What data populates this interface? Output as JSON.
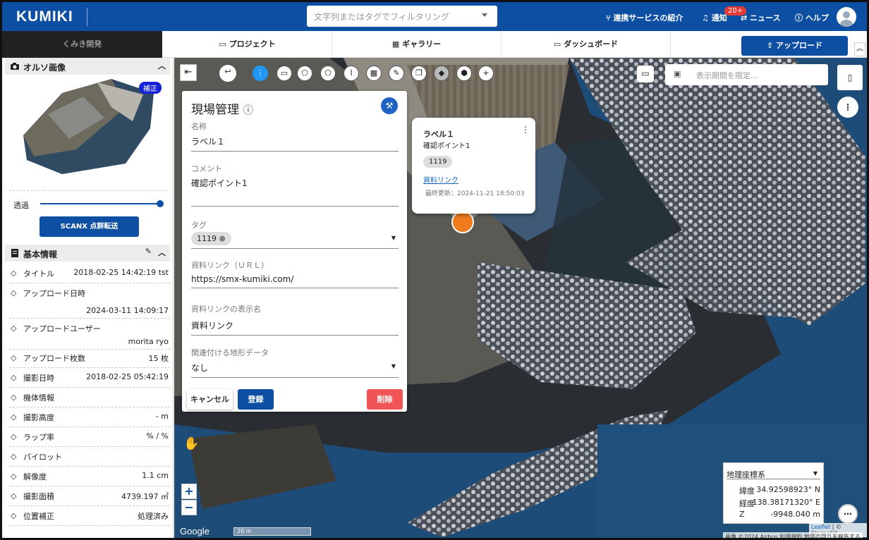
{
  "header": {
    "logo": "KUMIKI",
    "search_placeholder": "文字列またはタグでフィルタリング",
    "links": {
      "integration": "連携サービスの紹介",
      "notify": "通知",
      "notify_badge": "20+",
      "news": "ニュース",
      "help": "ヘルプ"
    }
  },
  "nav": {
    "org": "くみき開発",
    "tabs": [
      "プロジェクト",
      "ギャラリー",
      "ダッシュボード"
    ],
    "upload": "アップロード"
  },
  "sidebar": {
    "ortho_title": "オルソ画像",
    "ortho_badge": "補正",
    "opacity_label": "透過",
    "opacity_value": 1.0,
    "scanx_button": "SCANX 点群転送",
    "basic_title": "基本情報",
    "rows": [
      {
        "label": "タイトル",
        "value": "2018-02-25 14:42:19 tst"
      },
      {
        "label": "アップロード日時",
        "value": "2024-03-11 14:09:17"
      },
      {
        "label": "アップロードユーザー",
        "value": "morita ryo"
      },
      {
        "label": "アップロード枚数",
        "value": "15 枚"
      },
      {
        "label": "撮影日時",
        "value": "2018-02-25 05:42:19"
      },
      {
        "label": "機体情報",
        "value": ""
      },
      {
        "label": "撮影高度",
        "value": "- m"
      },
      {
        "label": "ラップ率",
        "value": "% / %"
      },
      {
        "label": "パイロット",
        "value": ""
      },
      {
        "label": "解像度",
        "value": "1.1 cm"
      },
      {
        "label": "撮影面積",
        "value": "4739.197 ㎡"
      },
      {
        "label": "位置補正",
        "value": "処理済み"
      }
    ]
  },
  "panel": {
    "title": "現場管理",
    "name_label": "名称",
    "name_value": "ラベル１",
    "comment_label": "コメント",
    "comment_value": "確認ポイント1",
    "tag_label": "タグ",
    "tag_chip": "1119",
    "link_label": "資料リンク（ＵＲＬ）",
    "link_value": "https://smx-kumiki.com/",
    "link_name_label": "資料リンクの表示名",
    "link_name_value": "資料リンク",
    "terrain_label": "関連付ける地形データ",
    "terrain_value": "なし",
    "cancel": "キャンセル",
    "save": "登録",
    "delete": "削除"
  },
  "popup": {
    "title": "ラベル１",
    "comment": "確認ポイント1",
    "chip": "1119",
    "link": "資料リンク",
    "updated": "最終更新：2024-11-21 18:50:03"
  },
  "map": {
    "date_placeholder": "表示期間を限定...",
    "scale": "20 m",
    "google": "Google",
    "attribution_left": "画像 ©2024 Airbus",
    "terms": "利用規約",
    "report": "地図の誤りを報告する",
    "leaflet": "Leaflet",
    "skymatix": "| © SkymatiX"
  },
  "coords": {
    "system": "地理座標系",
    "lat_label": "緯度",
    "lat": "34.92598923° N",
    "lon_label": "経度",
    "lon": "138.38171320° E",
    "z_label": "Z",
    "z": "-9948.040 m"
  },
  "colors": {
    "brand": "#0d4fa3",
    "danger": "#f05454",
    "marker": "#f07c1e"
  }
}
